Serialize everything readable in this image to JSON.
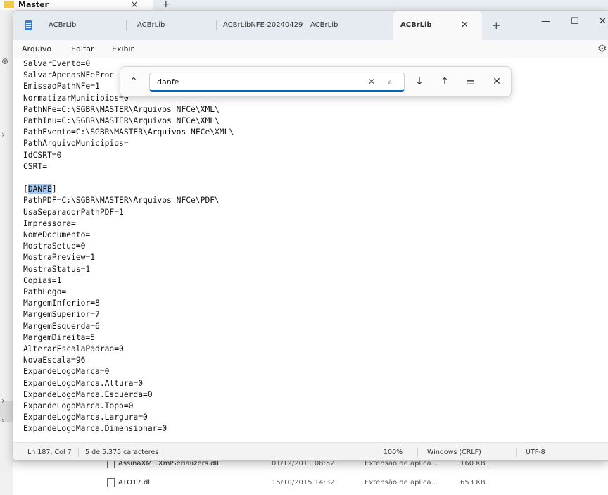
{
  "background_window": {
    "tab_title": "Master",
    "files": [
      {
        "name": "AssinaXML.XmlSerializers.dll",
        "date": "01/12/2011 08:52",
        "type": "Extensão de aplica...",
        "size": "160 KB"
      },
      {
        "name": "ATO17.dll",
        "date": "15/10/2015 14:32",
        "type": "Extensão de aplica...",
        "size": "653 KB"
      }
    ]
  },
  "notepad": {
    "tabs": [
      {
        "label": "ACBrLib"
      },
      {
        "label": "ACBrLib"
      },
      {
        "label": "ACBrLibNFE-20240429"
      },
      {
        "label": "ACBrLib"
      },
      {
        "label": "ACBrLib",
        "active": true
      }
    ],
    "menu": [
      "Arquivo",
      "Editar",
      "Exibir"
    ],
    "find": {
      "query": "danfe"
    },
    "lines": [
      "SalvarEvento=0",
      "SalvarApenasNFeProc",
      "EmissaoPathNFe=1",
      "NormatizarMunicipios=0",
      "PathNFe=C:\\SGBR\\MASTER\\Arquivos NFCe\\XML\\",
      "PathInu=C:\\SGBR\\MASTER\\Arquivos NFCe\\XML\\",
      "PathEvento=C:\\SGBR\\MASTER\\Arquivos NFCe\\XML\\",
      "PathArquivoMunicipios=",
      "IdCSRT=0",
      "CSRT=",
      "",
      "[DANFE]",
      "PathPDF=C:\\SGBR\\MASTER\\Arquivos NFCe\\PDF\\",
      "UsaSeparadorPathPDF=1",
      "Impressora=",
      "NomeDocumento=",
      "MostraSetup=0",
      "MostraPreview=1",
      "MostraStatus=1",
      "Copias=1",
      "PathLogo=",
      "MargemInferior=8",
      "MargemSuperior=7",
      "MargemEsquerda=6",
      "MargemDireita=5",
      "AlterarEscalaPadrao=0",
      "NovaEscala=96",
      "ExpandeLogoMarca=0",
      "ExpandeLogoMarca.Altura=0",
      "ExpandeLogoMarca.Esquerda=0",
      "ExpandeLogoMarca.Topo=0",
      "ExpandeLogoMarca.Largura=0",
      "ExpandeLogoMarca.Dimensionar=0"
    ],
    "highlight": {
      "pre": "[",
      "match": "DANFE",
      "post": "]"
    },
    "status": {
      "position": "Ln 187, Col 7",
      "selection": "5 de 5.375 caracteres",
      "zoom": "100%",
      "line_ending": "Windows (CRLF)",
      "encoding": "UTF-8"
    }
  }
}
